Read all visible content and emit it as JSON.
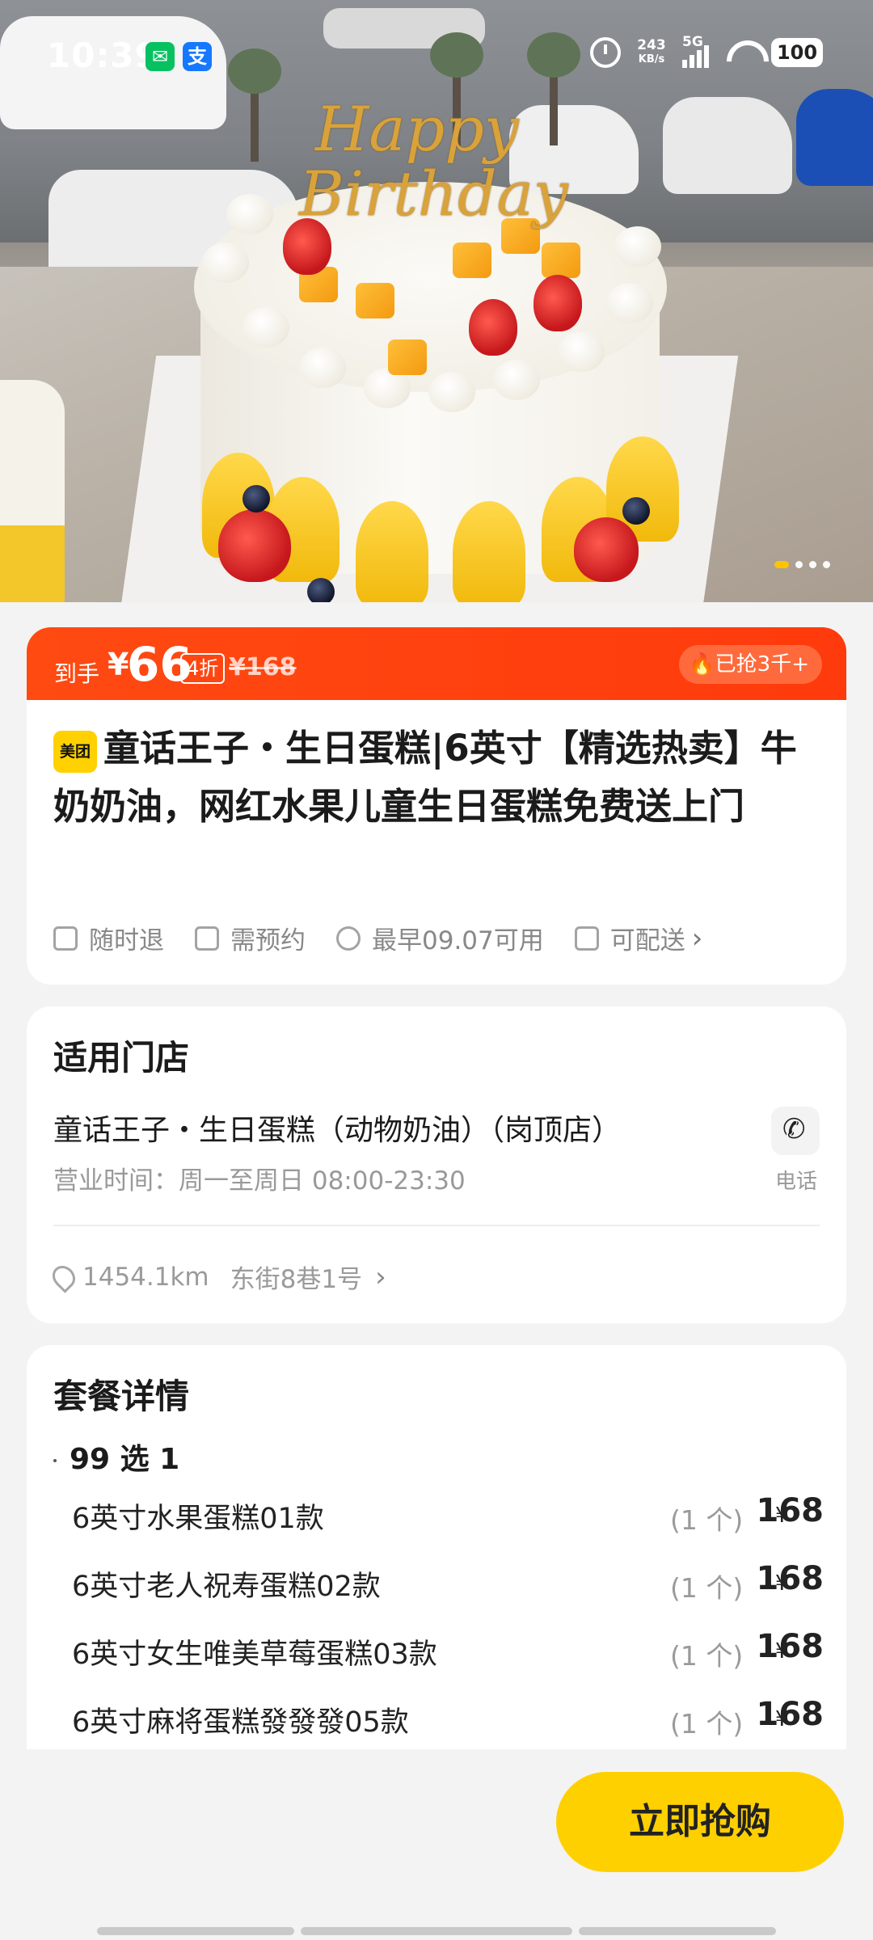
{
  "status_bar": {
    "time": "10:39",
    "net_speed_value": "243",
    "net_speed_unit": "KB/s",
    "network": "5G",
    "battery": "100"
  },
  "hero": {
    "topper_line1": "Happy",
    "topper_line2": "Birthday",
    "slide_count": 4,
    "active_slide": 1
  },
  "price_bar": {
    "label": "到手",
    "currency": "¥",
    "price": "66",
    "discount": "4折",
    "original_price": "¥168",
    "badge": "已抢3千+"
  },
  "product": {
    "platform_tag": "美团",
    "title": "童话王子・生日蛋糕|6英寸【精选热卖】牛奶奶油，网红水果儿童生日蛋糕免费送上门",
    "features": [
      "随时退",
      "需预约",
      "最早09.07可用",
      "可配送"
    ]
  },
  "store": {
    "section_title": "适用门店",
    "name": "童话王子・生日蛋糕（动物奶油）（岗顶店）",
    "hours": "营业时间：周一至周日 08:00-23:30",
    "phone_label": "电话",
    "distance": "1454.1km",
    "address": "东街8巷1号"
  },
  "package": {
    "section_title": "套餐详情",
    "subtitle": "99 选 1",
    "items": [
      {
        "name": "6英寸水果蛋糕01款",
        "qty": "(1 个)",
        "currency": "¥",
        "price": "168"
      },
      {
        "name": "6英寸老人祝寿蛋糕02款",
        "qty": "(1 个)",
        "currency": "¥",
        "price": "168"
      },
      {
        "name": "6英寸女生唯美草莓蛋糕03款",
        "qty": "(1 个)",
        "currency": "¥",
        "price": "168"
      },
      {
        "name": "6英寸麻将蛋糕發發發05款",
        "qty": "(1 个)",
        "currency": "¥",
        "price": "168"
      }
    ]
  },
  "actions": {
    "buy_label": "立即抢购"
  },
  "colors": {
    "accent_orange": "#ff4a12",
    "buy_yellow": "#ffd000"
  }
}
